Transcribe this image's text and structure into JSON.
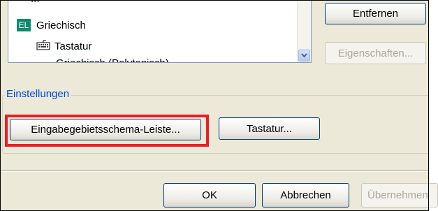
{
  "languages": {
    "items": [
      {
        "badge": "",
        "label": "..."
      },
      {
        "badge": "EL",
        "label": "Griechisch"
      },
      {
        "badge": "",
        "label": "Tastatur"
      },
      {
        "badge": "",
        "label": "Griechisch (Polytonisch)"
      }
    ]
  },
  "buttons": {
    "remove": "Entfernen",
    "properties": "Eigenschaften...",
    "language_bar": "Eingabegebietsschema-Leiste...",
    "keyboard": "Tastatur...",
    "ok": "OK",
    "cancel": "Abbrechen",
    "apply": "Übernehmen"
  },
  "settings": {
    "group_label": "Einstellungen"
  },
  "colors": {
    "highlight": "#ee1c24",
    "group_label": "#0046d5",
    "badge": "#0f8a70"
  }
}
